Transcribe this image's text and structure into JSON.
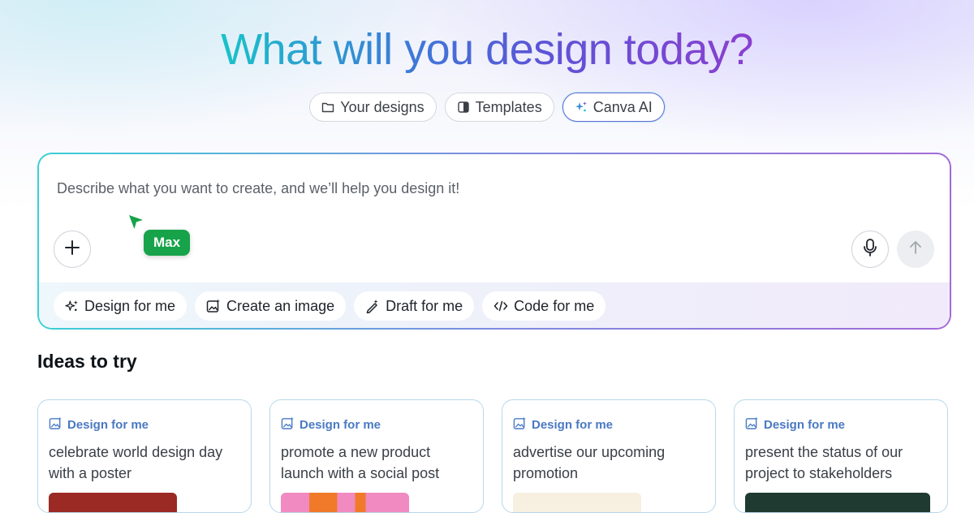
{
  "hero": {
    "title": "What will you design today?"
  },
  "mode_tabs": [
    {
      "label": "Your designs",
      "icon": "folder-icon"
    },
    {
      "label": "Templates",
      "icon": "template-icon"
    },
    {
      "label": "Canva AI",
      "icon": "sparkle-icon",
      "active": true
    }
  ],
  "prompt": {
    "placeholder": "Describe what you want to create, and we’ll help you design it!",
    "collaborator_name": "Max",
    "collaborator_color": "#16a34a",
    "add_icon": "plus-icon",
    "mic_icon": "microphone-icon",
    "send_icon": "arrow-up-icon"
  },
  "actions": [
    {
      "label": "Design for me",
      "icon": "sparkle-icon"
    },
    {
      "label": "Create an image",
      "icon": "image-sparkle-icon"
    },
    {
      "label": "Draft for me",
      "icon": "magic-pen-icon"
    },
    {
      "label": "Code for me",
      "icon": "code-icon"
    }
  ],
  "ideas": {
    "title": "Ideas to try",
    "cards": [
      {
        "tag": "Design for me",
        "text": "celebrate world design day with a poster",
        "thumb_color": "#9b2a24"
      },
      {
        "tag": "Design for me",
        "text": "promote a new product launch with a social post",
        "thumb_color": "#f08ac0"
      },
      {
        "tag": "Design for me",
        "text": "advertise our upcoming promotion",
        "thumb_color": "#f7efdf"
      },
      {
        "tag": "Design for me",
        "text": "present the status of our project to stakeholders",
        "thumb_color": "#1f3a30"
      }
    ]
  },
  "colors": {
    "accent_teal": "#19c3c9",
    "accent_purple": "#8a3fcf",
    "idea_tag_blue": "#4a79c3"
  }
}
